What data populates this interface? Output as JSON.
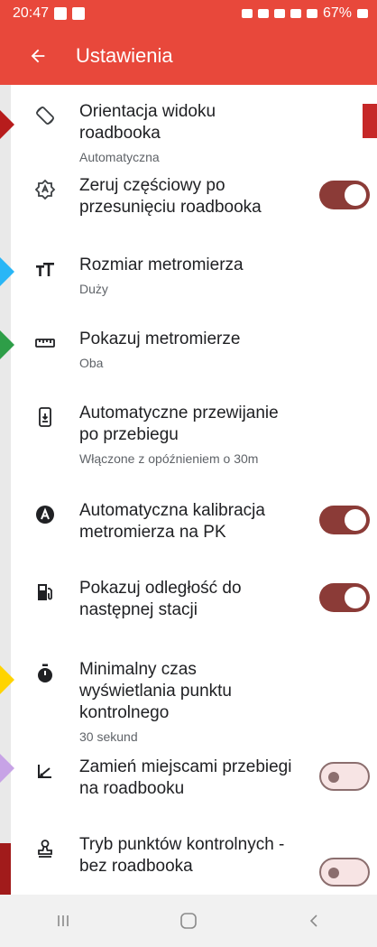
{
  "status_bar": {
    "time": "20:47",
    "battery": "67%"
  },
  "app_bar": {
    "back_icon": "arrow-left-icon",
    "title": "Ustawienia"
  },
  "settings": [
    {
      "icon": "screen-rotation-icon",
      "title": "Orientacja widoku roadbooka",
      "subtitle": "Automatyczna"
    },
    {
      "icon": "reset-icon",
      "title": "Zeruj częściowy po przesunięciu roadbooka",
      "toggle": "on"
    },
    {
      "icon": "text-size-icon",
      "title": "Rozmiar metromierza",
      "subtitle": "Duży"
    },
    {
      "icon": "ruler-icon",
      "title": "Pokazuj metromierze",
      "subtitle": "Oba"
    },
    {
      "icon": "auto-scroll-icon",
      "title": "Automatyczne przewijanie po przebiegu",
      "subtitle": "Włączone z opóźnieniem o 30m"
    },
    {
      "icon": "auto-calibration-icon",
      "title": "Automatyczna kalibracja metromierza na PK",
      "toggle": "on"
    },
    {
      "icon": "fuel-station-icon",
      "title": "Pokazuj odległość do następnej stacji",
      "toggle": "on"
    },
    {
      "icon": "timer-icon",
      "title": "Minimalny czas wyświetlania punktu kontrolnego",
      "subtitle": "30 sekund"
    },
    {
      "icon": "swap-distances-icon",
      "title": "Zamień miejscami przebiegi na roadbooku",
      "toggle": "off"
    },
    {
      "icon": "stamp-icon",
      "title": "Tryb punktów kontrolnych - bez roadbooka",
      "toggle": "off"
    }
  ],
  "nav_bar": {
    "recent_icon": "recent-apps-icon",
    "home_icon": "home-icon",
    "back_icon": "back-icon"
  },
  "colors": {
    "accent": "#e8483b",
    "toggle_on": "#8b3b37",
    "toggle_off": "#f7e4e4"
  }
}
